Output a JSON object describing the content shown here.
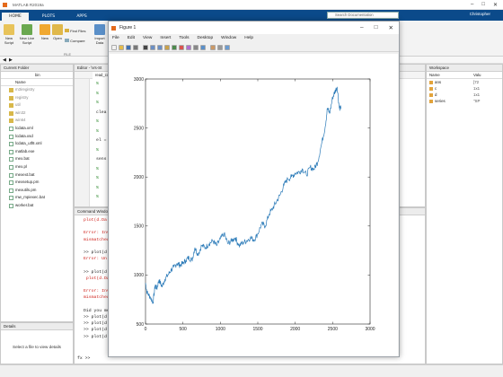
{
  "app": {
    "title": "MATLAB R2019a",
    "window_buttons": [
      "–",
      "□",
      "✕"
    ]
  },
  "ribbon": {
    "tabs": [
      "HOME",
      "PLOTS",
      "APPS"
    ],
    "buttons": [
      {
        "label": "New Script",
        "icon": "new-script-icon"
      },
      {
        "label": "New Live Script",
        "icon": "new-live-script-icon"
      },
      {
        "label": "New",
        "icon": "new-icon"
      },
      {
        "label": "Open",
        "icon": "open-folder-icon"
      },
      {
        "label": "Find Files",
        "icon": "find-files-icon"
      },
      {
        "label": "Compare",
        "icon": "compare-icon"
      },
      {
        "label": "Import Data",
        "icon": "import-data-icon"
      }
    ],
    "group_label": "FILE",
    "search_placeholder": "Search Documentation",
    "user": "Christopher"
  },
  "current_folder": {
    "title": "Current Folder",
    "path": "bin",
    "column": "Name",
    "items": [
      {
        "name": "m3iregistry",
        "type": "folder",
        "dim": true
      },
      {
        "name": "registry",
        "type": "folder",
        "dim": true
      },
      {
        "name": "util",
        "type": "folder",
        "dim": true
      },
      {
        "name": "win32",
        "type": "folder",
        "dim": true
      },
      {
        "name": "win64",
        "type": "folder",
        "dim": true
      },
      {
        "name": "lcdata.xml",
        "type": "file"
      },
      {
        "name": "lcdata.xsd",
        "type": "file"
      },
      {
        "name": "lcdata_utf8.xml",
        "type": "file"
      },
      {
        "name": "matlab.exe",
        "type": "file"
      },
      {
        "name": "mex.bat",
        "type": "file"
      },
      {
        "name": "mex.pl",
        "type": "file"
      },
      {
        "name": "mexext.bat",
        "type": "file"
      },
      {
        "name": "mexsetup.pm",
        "type": "file"
      },
      {
        "name": "mexutils.pm",
        "type": "file"
      },
      {
        "name": "mw_mpiexec.bat",
        "type": "file"
      },
      {
        "name": "worker.bat",
        "type": "file"
      }
    ]
  },
  "details": {
    "title": "Details",
    "message": "Select a file to view details"
  },
  "editor": {
    "title": "Editor - \\Vs-St",
    "tab": "read_corr",
    "lines": [
      "%",
      "%",
      "%",
      "clea",
      "%",
      "%",
      "el =",
      "%",
      "sens",
      "%",
      "%",
      "%",
      "%"
    ]
  },
  "command_window": {
    "title": "Command Window",
    "lines": [
      {
        "text": "plot(d.Da",
        "kind": "err"
      },
      {
        "text": "",
        "kind": "norm"
      },
      {
        "text": "Error: Inv",
        "kind": "err"
      },
      {
        "text": "mismatched",
        "kind": "err"
      },
      {
        "text": "",
        "kind": "norm"
      },
      {
        "text": ">> plot(d",
        "kind": "norm"
      },
      {
        "text": "Error: Un",
        "kind": "err"
      },
      {
        "text": "",
        "kind": "norm"
      },
      {
        "text": ">> plot(d.",
        "kind": "norm"
      },
      {
        "text": " plot(d.Da",
        "kind": "err"
      },
      {
        "text": "",
        "kind": "norm"
      },
      {
        "text": "Error: Inv",
        "kind": "err"
      },
      {
        "text": "mismatched",
        "kind": "err"
      },
      {
        "text": "",
        "kind": "norm"
      },
      {
        "text": "Did you me",
        "kind": "norm"
      },
      {
        "text": ">> plot(d.",
        "kind": "norm"
      },
      {
        "text": ">> plot(d.",
        "kind": "norm"
      },
      {
        "text": ">> plot(d.",
        "kind": "norm"
      },
      {
        "text": ">> plot(d.",
        "kind": "norm"
      }
    ],
    "prompt": "fx >>"
  },
  "workspace": {
    "title": "Workspace",
    "columns": [
      "Name",
      "Valu"
    ],
    "vars": [
      {
        "name": "ans",
        "value": "[72"
      },
      {
        "name": "c",
        "value": "1x1"
      },
      {
        "name": "d",
        "value": "1x1"
      },
      {
        "name": "series",
        "value": "\"SP"
      }
    ]
  },
  "figure": {
    "title": "Figure 1",
    "menu": [
      "File",
      "Edit",
      "View",
      "Insert",
      "Tools",
      "Desktop",
      "Window",
      "Help"
    ],
    "toolbar_icons": [
      "new-figure-icon",
      "open-icon",
      "save-icon",
      "print-icon",
      "pointer-icon",
      "zoom-in-icon",
      "zoom-out-icon",
      "pan-icon",
      "rotate-icon",
      "data-cursor-icon",
      "brush-icon",
      "link-icon",
      "colorbar-icon",
      "legend-icon",
      "hide-plot-tools-icon",
      "show-plot-tools-icon"
    ]
  },
  "chart_data": {
    "type": "line",
    "color": "#2a7ab8",
    "xlim": [
      0,
      3000
    ],
    "ylim": [
      500,
      3000
    ],
    "xticks": [
      0,
      500,
      1000,
      1500,
      2000,
      2500,
      3000
    ],
    "yticks": [
      500,
      1000,
      1500,
      2000,
      2500,
      3000
    ],
    "xlabel": "",
    "ylabel": "",
    "title": "",
    "grid": false,
    "series": [
      {
        "x": [
          0,
          20,
          60,
          100,
          130,
          150,
          180,
          220,
          260,
          300,
          340,
          380,
          420,
          460,
          500,
          540,
          580,
          620,
          660,
          700,
          750,
          800,
          850,
          900,
          950,
          1000,
          1050,
          1100,
          1150,
          1200,
          1250,
          1300,
          1350,
          1400,
          1450,
          1500,
          1550,
          1600,
          1650,
          1700,
          1750,
          1800,
          1850,
          1900,
          1950,
          2000,
          2050,
          2100,
          2150,
          2200,
          2250,
          2300,
          2350,
          2400,
          2430,
          2460,
          2500,
          2530,
          2560,
          2590,
          2610
        ],
        "y": [
          920,
          820,
          780,
          720,
          900,
          860,
          950,
          880,
          960,
          1000,
          1050,
          1080,
          1120,
          1100,
          1120,
          1150,
          1180,
          1150,
          1280,
          1210,
          1300,
          1280,
          1320,
          1350,
          1300,
          1370,
          1420,
          1320,
          1350,
          1380,
          1300,
          1330,
          1350,
          1380,
          1360,
          1420,
          1520,
          1500,
          1620,
          1680,
          1750,
          1820,
          1920,
          1980,
          2000,
          2040,
          2050,
          2080,
          2020,
          2100,
          2080,
          2150,
          2330,
          2510,
          2700,
          2650,
          2810,
          2870,
          2920,
          2700,
          2720
        ]
      }
    ]
  }
}
